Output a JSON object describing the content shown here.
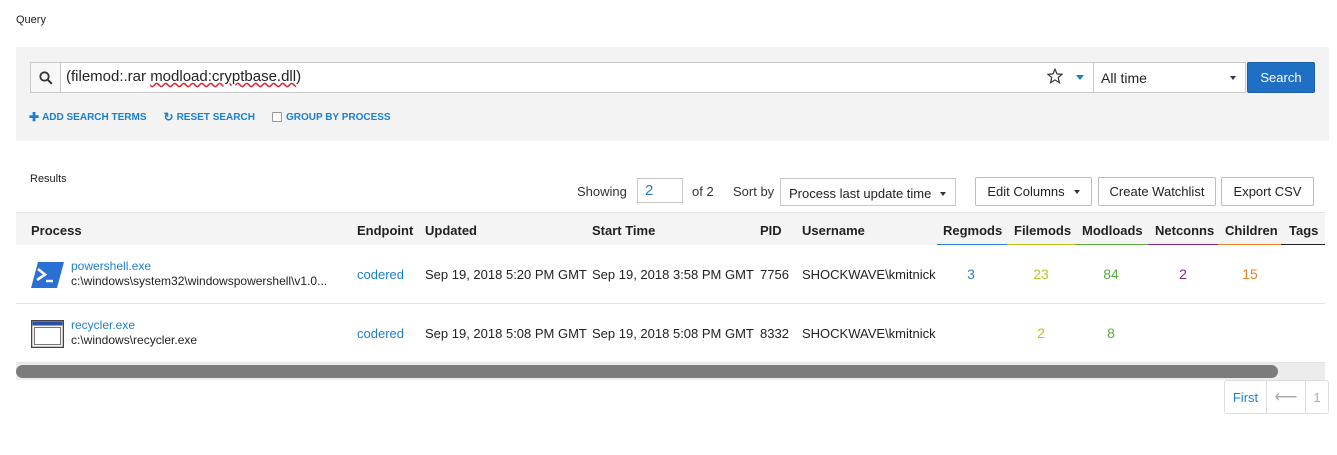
{
  "query": {
    "title": "Query",
    "search_value_a": "(filemod:.rar ",
    "search_value_b": "modload:cryptbase.dll",
    "search_value_c": ")",
    "time_range": "All time",
    "search_button": "Search",
    "add_terms": "ADD SEARCH TERMS",
    "reset": "RESET SEARCH",
    "group": "GROUP BY PROCESS"
  },
  "results": {
    "title": "Results",
    "showing_label": "Showing",
    "page_value": "2",
    "of_label": "of 2",
    "sortby_label": "Sort by",
    "sort_value": "Process last update time",
    "edit_columns": "Edit Columns",
    "create_watchlist": "Create Watchlist",
    "export_csv": "Export CSV"
  },
  "table": {
    "headers": {
      "process": "Process",
      "endpoint": "Endpoint",
      "updated": "Updated",
      "start_time": "Start Time",
      "pid": "PID",
      "username": "Username",
      "regmods": "Regmods",
      "filemods": "Filemods",
      "modloads": "Modloads",
      "netconns": "Netconns",
      "children": "Children",
      "tags": "Tags"
    },
    "rows": [
      {
        "name": "powershell.exe",
        "path": "c:\\windows\\system32\\windowspowershell\\v1.0...",
        "endpoint": "codered",
        "updated": "Sep 19, 2018 5:20 PM GMT",
        "start_time": "Sep 19, 2018 3:58 PM GMT",
        "pid": "7756",
        "username": "SHOCKWAVE\\kmitnick",
        "regmods": "3",
        "filemods": "23",
        "modloads": "84",
        "netconns": "2",
        "children": "15",
        "icon": "powershell-icon"
      },
      {
        "name": "recycler.exe",
        "path": "c:\\windows\\recycler.exe",
        "endpoint": "codered",
        "updated": "Sep 19, 2018 5:08 PM GMT",
        "start_time": "Sep 19, 2018 5:08 PM GMT",
        "pid": "8332",
        "username": "SHOCKWAVE\\kmitnick",
        "regmods": "",
        "filemods": "2",
        "modloads": "8",
        "netconns": "",
        "children": "",
        "icon": "window-app-icon"
      }
    ]
  },
  "pagination": {
    "first": "First",
    "prev": "⟵",
    "page": "1"
  },
  "colors": {
    "accent": "#1b7fd1",
    "regmods": "#2a7fd6",
    "filemods": "#c3c31f",
    "modloads": "#5aac3c",
    "netconns": "#7d2a93",
    "children": "#e87f24",
    "tags": "#222222"
  }
}
